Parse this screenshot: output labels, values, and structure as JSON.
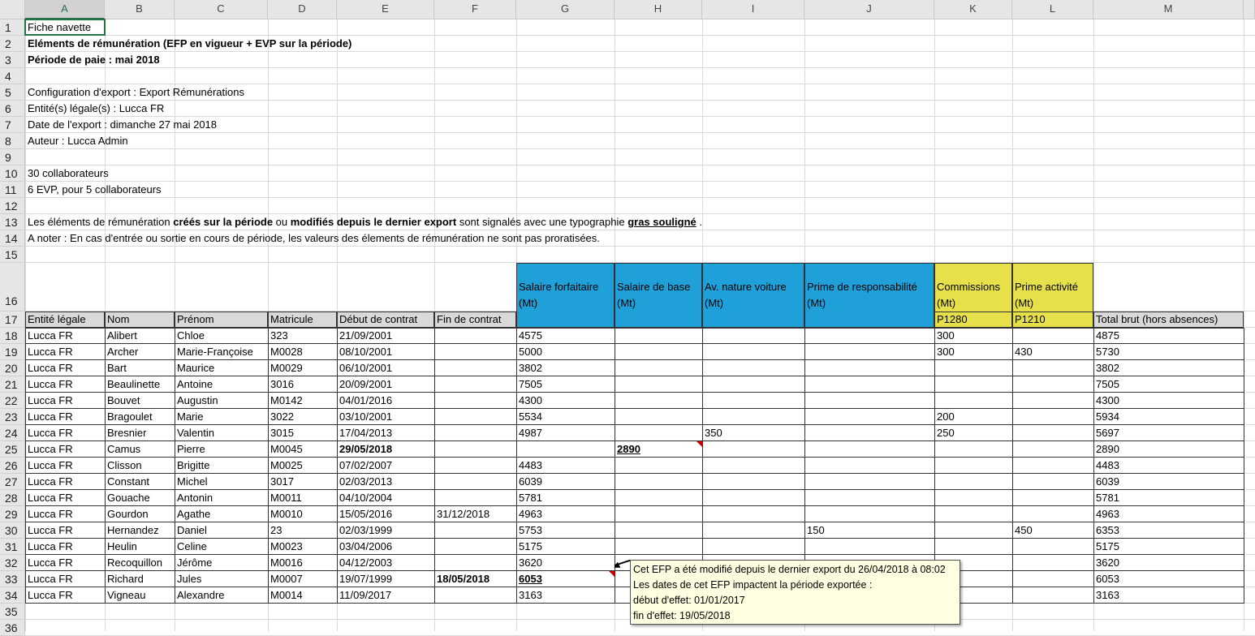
{
  "columns": [
    "A",
    "B",
    "C",
    "D",
    "E",
    "F",
    "G",
    "H",
    "I",
    "J",
    "K",
    "L",
    "M"
  ],
  "row_numbers": [
    "1",
    "2",
    "3",
    "4",
    "5",
    "6",
    "7",
    "8",
    "9",
    "10",
    "11",
    "12",
    "13",
    "14",
    "15",
    "16",
    "17",
    "18",
    "19",
    "20",
    "21",
    "22",
    "23",
    "24",
    "25",
    "26",
    "27",
    "28",
    "29",
    "30",
    "31",
    "32",
    "33",
    "34",
    "35",
    "36"
  ],
  "info": {
    "r1": "Fiche navette",
    "r2": "Eléments de rémunération (EFP en vigueur + EVP sur la période)",
    "r3": "Période de paie : mai 2018",
    "r5": "Configuration d'export : Export Rémunérations",
    "r6": "Entité(s) légale(s) : Lucca FR",
    "r7": "Date de l'export : dimanche 27 mai 2018",
    "r8": "Auteur : Lucca Admin",
    "r10": "30 collaborateurs",
    "r11": "6 EVP, pour 5 collaborateurs",
    "r13_a": "Les éléments de rémunération ",
    "r13_b": "créés sur la période",
    "r13_c": " ou ",
    "r13_d": "modifiés depuis le dernier export",
    "r13_e": " sont signalés avec une typographie ",
    "r13_f": "gras souligné",
    "r13_g": " .",
    "r14": "A noter : En cas d'entrée ou sortie en cours de période, les valeurs des élements de rémunération ne sont pas proratisées."
  },
  "group_headers": {
    "g": [
      "Salaire forfaitaire",
      "(Mt)"
    ],
    "h": [
      "Salaire de base",
      "(Mt)"
    ],
    "i": [
      "Av. nature voiture",
      "(Mt)"
    ],
    "j": [
      "Prime de responsabilité",
      "(Mt)"
    ],
    "k": [
      "Commissions",
      "(Mt)"
    ],
    "l": [
      "Prime activité",
      "(Mt)"
    ],
    "k17": "P1280",
    "l17": "P1210"
  },
  "table_headers": [
    "Entité légale",
    "Nom",
    "Prénom",
    "Matricule",
    "Début de contrat",
    "Fin de contrat",
    "",
    "",
    "",
    "",
    "",
    "",
    "Total brut (hors absences)"
  ],
  "rows": [
    [
      "Lucca FR",
      "Alibert",
      "Chloe",
      "323",
      "21/09/2001",
      "",
      "4575",
      "",
      "",
      "",
      "300",
      "",
      "4875"
    ],
    [
      "Lucca FR",
      "Archer",
      "Marie-Françoise",
      "M0028",
      "08/10/2001",
      "",
      "5000",
      "",
      "",
      "",
      "300",
      "430",
      "5730"
    ],
    [
      "Lucca FR",
      "Bart",
      "Maurice",
      "M0029",
      "06/10/2001",
      "",
      "3802",
      "",
      "",
      "",
      "",
      "",
      "3802"
    ],
    [
      "Lucca FR",
      "Beaulinette",
      "Antoine",
      "3016",
      "20/09/2001",
      "",
      "7505",
      "",
      "",
      "",
      "",
      "",
      "7505"
    ],
    [
      "Lucca FR",
      "Bouvet",
      "Augustin",
      "M0142",
      "04/01/2016",
      "",
      "4300",
      "",
      "",
      "",
      "",
      "",
      "4300"
    ],
    [
      "Lucca FR",
      "Bragoulet",
      "Marie",
      "3022",
      "03/10/2001",
      "",
      "5534",
      "",
      "",
      "",
      "200",
      "",
      "5934"
    ],
    [
      "Lucca FR",
      "Bresnier",
      "Valentin",
      "3015",
      "17/04/2013",
      "",
      "4987",
      "",
      "350",
      "",
      "250",
      "",
      "5697"
    ],
    [
      "Lucca FR",
      "Camus",
      "Pierre",
      "M0045",
      "29/05/2018",
      "",
      "",
      "2890",
      "",
      "",
      "",
      "",
      "2890"
    ],
    [
      "Lucca FR",
      "Clisson",
      "Brigitte",
      "M0025",
      "07/02/2007",
      "",
      "4483",
      "",
      "",
      "",
      "",
      "",
      "4483"
    ],
    [
      "Lucca FR",
      "Constant",
      "Michel",
      "3017",
      "02/03/2013",
      "",
      "6039",
      "",
      "",
      "",
      "",
      "",
      "6039"
    ],
    [
      "Lucca FR",
      "Gouache",
      "Antonin",
      "M0011",
      "04/10/2004",
      "",
      "5781",
      "",
      "",
      "",
      "",
      "",
      "5781"
    ],
    [
      "Lucca FR",
      "Gourdon",
      "Agathe",
      "M0010",
      "15/05/2016",
      "31/12/2018",
      "4963",
      "",
      "",
      "",
      "",
      "",
      "4963"
    ],
    [
      "Lucca FR",
      "Hernandez",
      "Daniel",
      "23",
      "02/03/1999",
      "",
      "5753",
      "",
      "",
      "150",
      "",
      "450",
      "6353"
    ],
    [
      "Lucca FR",
      "Heulin",
      "Celine",
      "M0023",
      "03/04/2006",
      "",
      "5175",
      "",
      "",
      "",
      "",
      "",
      "5175"
    ],
    [
      "Lucca FR",
      "Recoquillon",
      "Jérôme",
      "M0016",
      "04/12/2003",
      "",
      "3620",
      "",
      "",
      "",
      "",
      "",
      "3620"
    ],
    [
      "Lucca FR",
      "Richard",
      "Jules",
      "M0007",
      "19/07/1999",
      "18/05/2018",
      "6053",
      "",
      "",
      "",
      "",
      "",
      "6053"
    ],
    [
      "Lucca FR",
      "Vigneau",
      "Alexandre",
      "M0014",
      "11/09/2017",
      "",
      "3163",
      "",
      "",
      "",
      "",
      "",
      "3163"
    ]
  ],
  "comment": [
    "Cet EFP a été modifié depuis le dernier export du 26/04/2018 à 08:02",
    "Les dates de cet EFP impactent la période exportée :",
    "début d'effet: 01/01/2017",
    "fin d'effet: 19/05/2018"
  ],
  "colors": {
    "blue_header": "#1fa0d8",
    "yellow_header": "#e6e04a",
    "header_gray": "#d9d9d9",
    "comment_bg": "#ffffe1"
  }
}
